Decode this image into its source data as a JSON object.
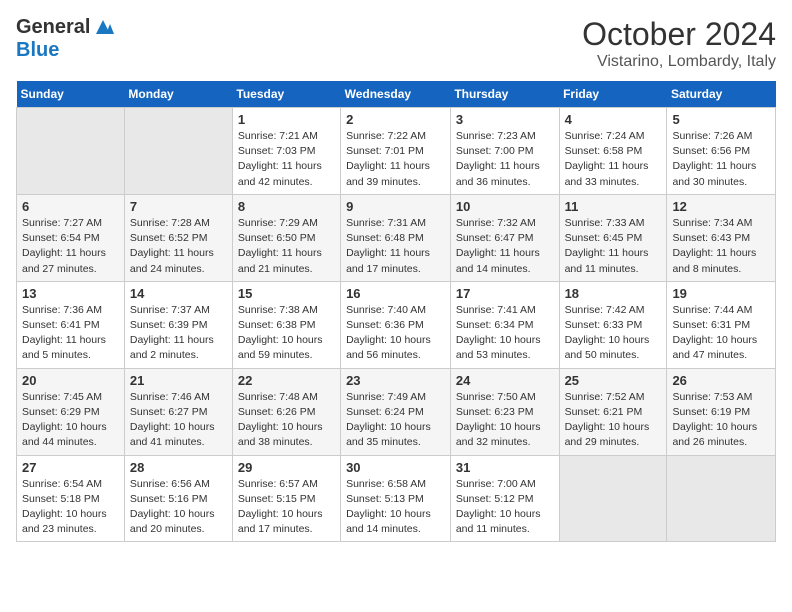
{
  "header": {
    "logo_general": "General",
    "logo_blue": "Blue",
    "month_title": "October 2024",
    "location": "Vistarino, Lombardy, Italy"
  },
  "days_of_week": [
    "Sunday",
    "Monday",
    "Tuesday",
    "Wednesday",
    "Thursday",
    "Friday",
    "Saturday"
  ],
  "weeks": [
    [
      {
        "day": "",
        "content": ""
      },
      {
        "day": "",
        "content": ""
      },
      {
        "day": "1",
        "content": "Sunrise: 7:21 AM\nSunset: 7:03 PM\nDaylight: 11 hours and 42 minutes."
      },
      {
        "day": "2",
        "content": "Sunrise: 7:22 AM\nSunset: 7:01 PM\nDaylight: 11 hours and 39 minutes."
      },
      {
        "day": "3",
        "content": "Sunrise: 7:23 AM\nSunset: 7:00 PM\nDaylight: 11 hours and 36 minutes."
      },
      {
        "day": "4",
        "content": "Sunrise: 7:24 AM\nSunset: 6:58 PM\nDaylight: 11 hours and 33 minutes."
      },
      {
        "day": "5",
        "content": "Sunrise: 7:26 AM\nSunset: 6:56 PM\nDaylight: 11 hours and 30 minutes."
      }
    ],
    [
      {
        "day": "6",
        "content": "Sunrise: 7:27 AM\nSunset: 6:54 PM\nDaylight: 11 hours and 27 minutes."
      },
      {
        "day": "7",
        "content": "Sunrise: 7:28 AM\nSunset: 6:52 PM\nDaylight: 11 hours and 24 minutes."
      },
      {
        "day": "8",
        "content": "Sunrise: 7:29 AM\nSunset: 6:50 PM\nDaylight: 11 hours and 21 minutes."
      },
      {
        "day": "9",
        "content": "Sunrise: 7:31 AM\nSunset: 6:48 PM\nDaylight: 11 hours and 17 minutes."
      },
      {
        "day": "10",
        "content": "Sunrise: 7:32 AM\nSunset: 6:47 PM\nDaylight: 11 hours and 14 minutes."
      },
      {
        "day": "11",
        "content": "Sunrise: 7:33 AM\nSunset: 6:45 PM\nDaylight: 11 hours and 11 minutes."
      },
      {
        "day": "12",
        "content": "Sunrise: 7:34 AM\nSunset: 6:43 PM\nDaylight: 11 hours and 8 minutes."
      }
    ],
    [
      {
        "day": "13",
        "content": "Sunrise: 7:36 AM\nSunset: 6:41 PM\nDaylight: 11 hours and 5 minutes."
      },
      {
        "day": "14",
        "content": "Sunrise: 7:37 AM\nSunset: 6:39 PM\nDaylight: 11 hours and 2 minutes."
      },
      {
        "day": "15",
        "content": "Sunrise: 7:38 AM\nSunset: 6:38 PM\nDaylight: 10 hours and 59 minutes."
      },
      {
        "day": "16",
        "content": "Sunrise: 7:40 AM\nSunset: 6:36 PM\nDaylight: 10 hours and 56 minutes."
      },
      {
        "day": "17",
        "content": "Sunrise: 7:41 AM\nSunset: 6:34 PM\nDaylight: 10 hours and 53 minutes."
      },
      {
        "day": "18",
        "content": "Sunrise: 7:42 AM\nSunset: 6:33 PM\nDaylight: 10 hours and 50 minutes."
      },
      {
        "day": "19",
        "content": "Sunrise: 7:44 AM\nSunset: 6:31 PM\nDaylight: 10 hours and 47 minutes."
      }
    ],
    [
      {
        "day": "20",
        "content": "Sunrise: 7:45 AM\nSunset: 6:29 PM\nDaylight: 10 hours and 44 minutes."
      },
      {
        "day": "21",
        "content": "Sunrise: 7:46 AM\nSunset: 6:27 PM\nDaylight: 10 hours and 41 minutes."
      },
      {
        "day": "22",
        "content": "Sunrise: 7:48 AM\nSunset: 6:26 PM\nDaylight: 10 hours and 38 minutes."
      },
      {
        "day": "23",
        "content": "Sunrise: 7:49 AM\nSunset: 6:24 PM\nDaylight: 10 hours and 35 minutes."
      },
      {
        "day": "24",
        "content": "Sunrise: 7:50 AM\nSunset: 6:23 PM\nDaylight: 10 hours and 32 minutes."
      },
      {
        "day": "25",
        "content": "Sunrise: 7:52 AM\nSunset: 6:21 PM\nDaylight: 10 hours and 29 minutes."
      },
      {
        "day": "26",
        "content": "Sunrise: 7:53 AM\nSunset: 6:19 PM\nDaylight: 10 hours and 26 minutes."
      }
    ],
    [
      {
        "day": "27",
        "content": "Sunrise: 6:54 AM\nSunset: 5:18 PM\nDaylight: 10 hours and 23 minutes."
      },
      {
        "day": "28",
        "content": "Sunrise: 6:56 AM\nSunset: 5:16 PM\nDaylight: 10 hours and 20 minutes."
      },
      {
        "day": "29",
        "content": "Sunrise: 6:57 AM\nSunset: 5:15 PM\nDaylight: 10 hours and 17 minutes."
      },
      {
        "day": "30",
        "content": "Sunrise: 6:58 AM\nSunset: 5:13 PM\nDaylight: 10 hours and 14 minutes."
      },
      {
        "day": "31",
        "content": "Sunrise: 7:00 AM\nSunset: 5:12 PM\nDaylight: 10 hours and 11 minutes."
      },
      {
        "day": "",
        "content": ""
      },
      {
        "day": "",
        "content": ""
      }
    ]
  ]
}
